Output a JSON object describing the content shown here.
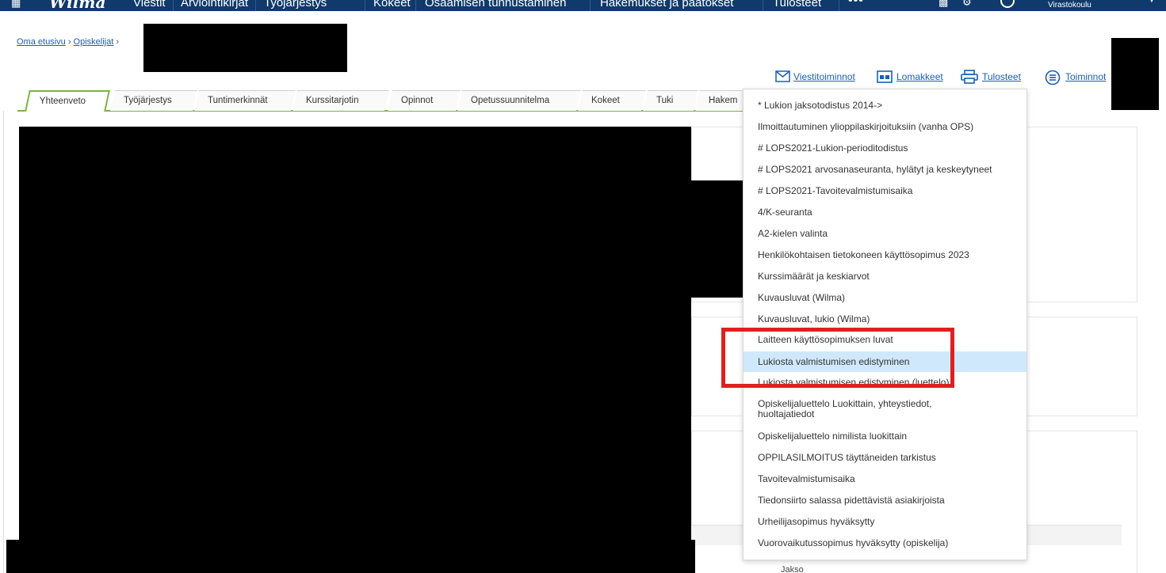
{
  "topnav": {
    "items": [
      "Viestit",
      "Arviointikirjat",
      "Työjärjestys",
      "Kokeet",
      "Osaamisen tunnustaminen",
      "Hakemukset ja päätökset",
      "Tulosteet"
    ],
    "more": "•••",
    "school": "Virastokoulu"
  },
  "breadcrumb": {
    "home": "Oma etusivu",
    "students": "Opiskelijat",
    "separator": "›"
  },
  "actions": {
    "messages": "Viestitoiminnot",
    "forms": "Lomakkeet",
    "printouts": "Tulosteet",
    "functions": "Toiminnot"
  },
  "tabs": [
    "Yhteenveto",
    "Työjärjestys",
    "Tuntimerkinnät",
    "Kurssitarjotin",
    "Opinnot",
    "Opetussuunnitelma",
    "Kokeet",
    "Tuki",
    "Hakem"
  ],
  "menu": {
    "items": [
      "* Lukion jaksotodistus 2014->",
      "Ilmoittautuminen ylioppilaskirjoituksiin (vanha OPS)",
      "# LOPS2021-Lukion-perioditodistus",
      "# LOPS2021 arvosanaseuranta, hylätyt ja keskeytyneet",
      "# LOPS2021-Tavoitevalmistumisaika",
      "4/K-seuranta",
      "A2-kielen valinta",
      "Henkilökohtaisen tietokoneen käyttösopimus 2023",
      "Kurssimäärät ja keskiarvot",
      "Kuvausluvat (Wilma)",
      "Kuvausluvat, lukio (Wilma)",
      "Laitteen käyttösopimuksen luvat",
      "Lukiosta valmistumisen edistyminen",
      "Lukiosta valmistumisen edistyminen (luettelo)",
      "Opiskelijaluettelo Luokittain, yhteystiedot,",
      "huoltajatiedot",
      "Opiskelijaluettelo nimilista luokittain",
      "OPPILASILMOITUS täyttäneiden tarkistus",
      "Tavoitevalmistumisaika",
      "Tiedonsiirto salassa pidettävistä asiakirjoista",
      "Urheilijasopimus hyväksytty",
      "Vuorovaikutussopimus hyväksytty (opiskelija)"
    ],
    "highlighted": "Lukiosta valmistumisen edistyminen"
  },
  "table": {
    "cell": "Jakso"
  },
  "colors": {
    "nav": "#0f3a6b",
    "accent": "#7cb342",
    "link": "#1a5fb4",
    "highlight": "#cfe8fb",
    "annotation": "#e02020"
  }
}
